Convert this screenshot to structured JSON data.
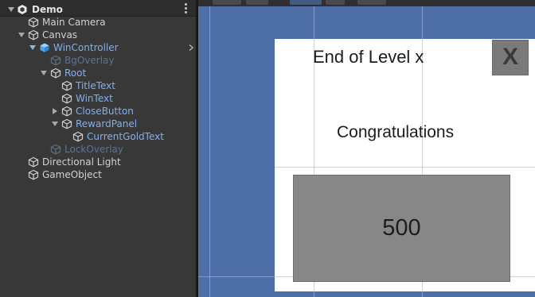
{
  "hierarchy": {
    "items": [
      {
        "label": "Demo"
      },
      {
        "label": "Main Camera"
      },
      {
        "label": "Canvas"
      },
      {
        "label": "WinController"
      },
      {
        "label": "BgOverlay"
      },
      {
        "label": "Root"
      },
      {
        "label": "TitleText"
      },
      {
        "label": "WinText"
      },
      {
        "label": "CloseButton"
      },
      {
        "label": "RewardPanel"
      },
      {
        "label": "CurrentGoldText"
      },
      {
        "label": "LockOverlay"
      },
      {
        "label": "Directional Light"
      },
      {
        "label": "GameObject"
      }
    ]
  },
  "scene": {
    "title_text": "End of Level x",
    "win_text": "Congratulations",
    "close_label": "X",
    "gold_value": "500"
  },
  "colors": {
    "prefab_blue": "#7eb0f3",
    "scene_background": "#4f6fa8",
    "panel_white": "#ffffff",
    "reward_panel_gray": "#878787"
  },
  "icons": [
    "unity-scene-icon",
    "gameobject-cube-icon",
    "prefab-cube-icon",
    "kebab-menu-icon",
    "chevron-right-icon"
  ]
}
